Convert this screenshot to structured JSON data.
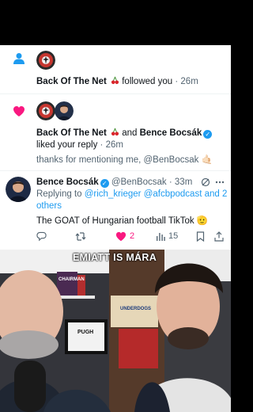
{
  "notifications": [
    {
      "type": "follow",
      "user": "Back Of The Net",
      "action_text": "followed you",
      "time": "· 26m"
    },
    {
      "type": "like",
      "user1": "Back Of The Net",
      "connector": "and",
      "user2": "Bence Bocsák",
      "action_text": "liked your reply",
      "time": "· 26m",
      "quote": "thanks for mentioning me, @BenBocsak 🤙🏻"
    }
  ],
  "tweet": {
    "name": "Bence Bocsák",
    "handle": "@BenBocsak",
    "time": "· 33m",
    "replying_prefix": "Replying to",
    "replying_to": "@rich_krieger @afcbpodcast and 2",
    "replying_to_more": "others",
    "text": "The GOAT of Hungarian football TikTok 🫡",
    "likes": "2",
    "views": "15"
  },
  "video": {
    "caption": "EMIATT IS MÁRA",
    "book1_title": "CHAIRMAN",
    "book2_title": "PUGH",
    "book3_title": "UNDERDOGS"
  },
  "colors": {
    "accent": "#1d9bf0",
    "like": "#f91880",
    "text": "#0f1419",
    "muted": "#536471"
  }
}
